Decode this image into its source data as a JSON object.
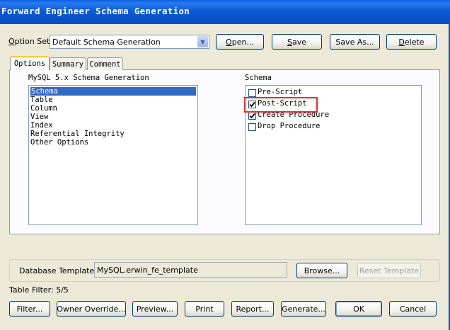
{
  "window": {
    "title": "Forward Engineer Schema Generation"
  },
  "option_set": {
    "label": "Option Set:",
    "value": "Default Schema Generation",
    "buttons": [
      "Open...",
      "Save",
      "Save As...",
      "Delete"
    ]
  },
  "tabs": [
    "Options",
    "Summary",
    "Comment"
  ],
  "left_list": {
    "heading": "MySQL 5.x Schema Generation",
    "items": [
      "Schema",
      "Table",
      "Column",
      "View",
      "Index",
      "Referential Integrity",
      "Other Options"
    ],
    "selected": "Schema"
  },
  "right_list": {
    "heading": "Schema",
    "items": [
      {
        "label": "Pre-Script",
        "checked": false
      },
      {
        "label": "Post-Script",
        "checked": true
      },
      {
        "label": "Create Procedure",
        "checked": true
      },
      {
        "label": "Drop Procedure",
        "checked": false
      }
    ]
  },
  "database_template": {
    "label": "Database Template:",
    "value": "MySQL.erwin_fe_template",
    "browse": "Browse...",
    "reset": "Reset Template"
  },
  "table_filter": "Table Filter: 5/5",
  "bottom_buttons": [
    "Filter...",
    "Owner Override...",
    "Preview...",
    "Print",
    "Report...",
    "Generate...",
    "OK",
    "Cancel"
  ],
  "colors": {
    "titlebar": "#0b5bd6",
    "selection": "#316ac5",
    "highlight_box": "#e03030",
    "dialog_bg": "#ece9d8"
  }
}
